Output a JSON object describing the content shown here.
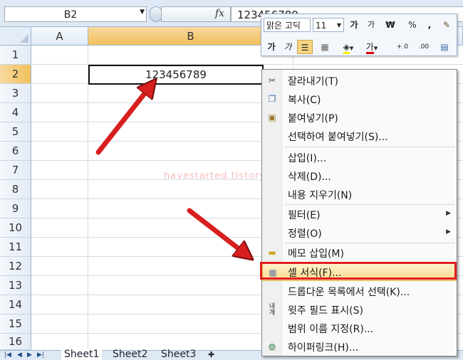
{
  "formula_bar": {
    "name_box": "B2",
    "fx_label": "fx",
    "value": "123456789"
  },
  "columns": [
    "A",
    "B"
  ],
  "rows": [
    "1",
    "2",
    "3",
    "4",
    "5",
    "6",
    "7",
    "8",
    "9",
    "10",
    "11",
    "12",
    "13",
    "14",
    "15",
    "16"
  ],
  "active_cell": {
    "value": "123456789"
  },
  "sheet_tabs": [
    "Sheet1",
    "Sheet2",
    "Sheet3"
  ],
  "mini_toolbar": {
    "font_name": "맑은 고딕",
    "font_size": "11",
    "grow_font": "가",
    "shrink_font": "가",
    "currency": "₩",
    "percent": "%",
    "comma": ",",
    "bold": "가",
    "italic": "가",
    "font_color": "가",
    "increase_decimal": "+.0",
    "decrease_decimal": ".00"
  },
  "context_menu": {
    "items": [
      {
        "label": "잘라내기(T)",
        "icon": "scissors-icon"
      },
      {
        "label": "복사(C)",
        "icon": "copy-icon"
      },
      {
        "label": "붙여넣기(P)",
        "icon": "paste-icon"
      },
      {
        "label": "선택하여 붙여넣기(S)...",
        "icon": ""
      },
      {
        "label": "삽입(I)...",
        "icon": ""
      },
      {
        "label": "삭제(D)...",
        "icon": ""
      },
      {
        "label": "내용 지우기(N)",
        "icon": ""
      },
      {
        "label": "필터(E)",
        "icon": ""
      },
      {
        "label": "정렬(O)",
        "icon": ""
      },
      {
        "label": "메모 삽입(M)",
        "icon": "comment-icon"
      },
      {
        "label": "셀 서식(F)...",
        "icon": "format-cells-icon"
      },
      {
        "label": "드롭다운 목록에서 선택(K)...",
        "icon": ""
      },
      {
        "label": "윗주 필드 표시(S)",
        "icon": "phonetic-icon"
      },
      {
        "label": "범위 이름 지정(R)...",
        "icon": ""
      },
      {
        "label": "하이퍼링크(H)...",
        "icon": "hyperlink-icon"
      }
    ]
  },
  "watermark": "havestarted.tistory",
  "colors": {
    "highlight": "#e02020",
    "arrow": "#d81f1f",
    "selected_header": "#f1c05c"
  }
}
